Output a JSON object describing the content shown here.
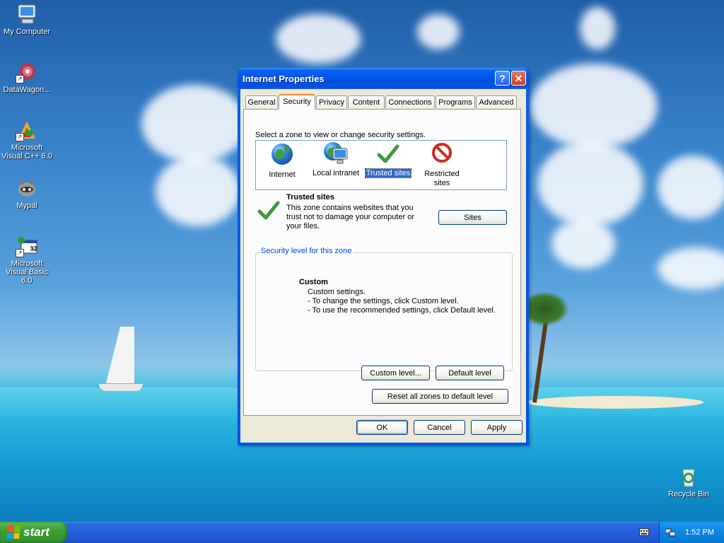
{
  "desktop": {
    "icons": [
      {
        "label": "My Computer"
      },
      {
        "label": "DataWagon..."
      },
      {
        "label": "Microsoft Visual C++ 6.0"
      },
      {
        "label": "Mypal"
      },
      {
        "label": "Microsoft Visual Basic 6.0"
      },
      {
        "label": "Recycle Bin"
      }
    ]
  },
  "taskbar": {
    "start_label": "start",
    "clock": "1:52 PM"
  },
  "dialog": {
    "title": "Internet Properties",
    "help_glyph": "?",
    "close_glyph": "✕",
    "tabs": [
      {
        "label": "General"
      },
      {
        "label": "Security"
      },
      {
        "label": "Privacy"
      },
      {
        "label": "Content"
      },
      {
        "label": "Connections"
      },
      {
        "label": "Programs"
      },
      {
        "label": "Advanced"
      }
    ],
    "active_tab": "Security",
    "security": {
      "instruction": "Select a zone to view or change security settings.",
      "zones": [
        {
          "label": "Internet",
          "icon": "globe-icon"
        },
        {
          "label": "Local intranet",
          "icon": "globe-computer-icon"
        },
        {
          "label": "Trusted sites",
          "icon": "checkmark-icon",
          "selected": true
        },
        {
          "label": "Restricted sites",
          "icon": "no-entry-icon"
        }
      ],
      "zone_title": "Trusted sites",
      "zone_desc": "This zone contains websites that you trust not to damage your computer or your files.",
      "sites_button": "Sites",
      "level_group_label": "Security level for this zone",
      "level_name": "Custom",
      "level_lines": [
        "Custom settings.",
        "- To change the settings, click Custom level.",
        "- To use the recommended settings, click Default level."
      ],
      "custom_level_button": "Custom level...",
      "default_level_button": "Default level",
      "reset_button": "Reset all zones to default level"
    },
    "buttons": {
      "ok": "OK",
      "cancel": "Cancel",
      "apply": "Apply"
    }
  },
  "colors": {
    "titlebar": "#0153e4",
    "dialog_face": "#ece9d8",
    "selection": "#316ac5",
    "group_label": "#0046d5",
    "taskbar": "#245edb",
    "start_green": "#3c9f35"
  }
}
